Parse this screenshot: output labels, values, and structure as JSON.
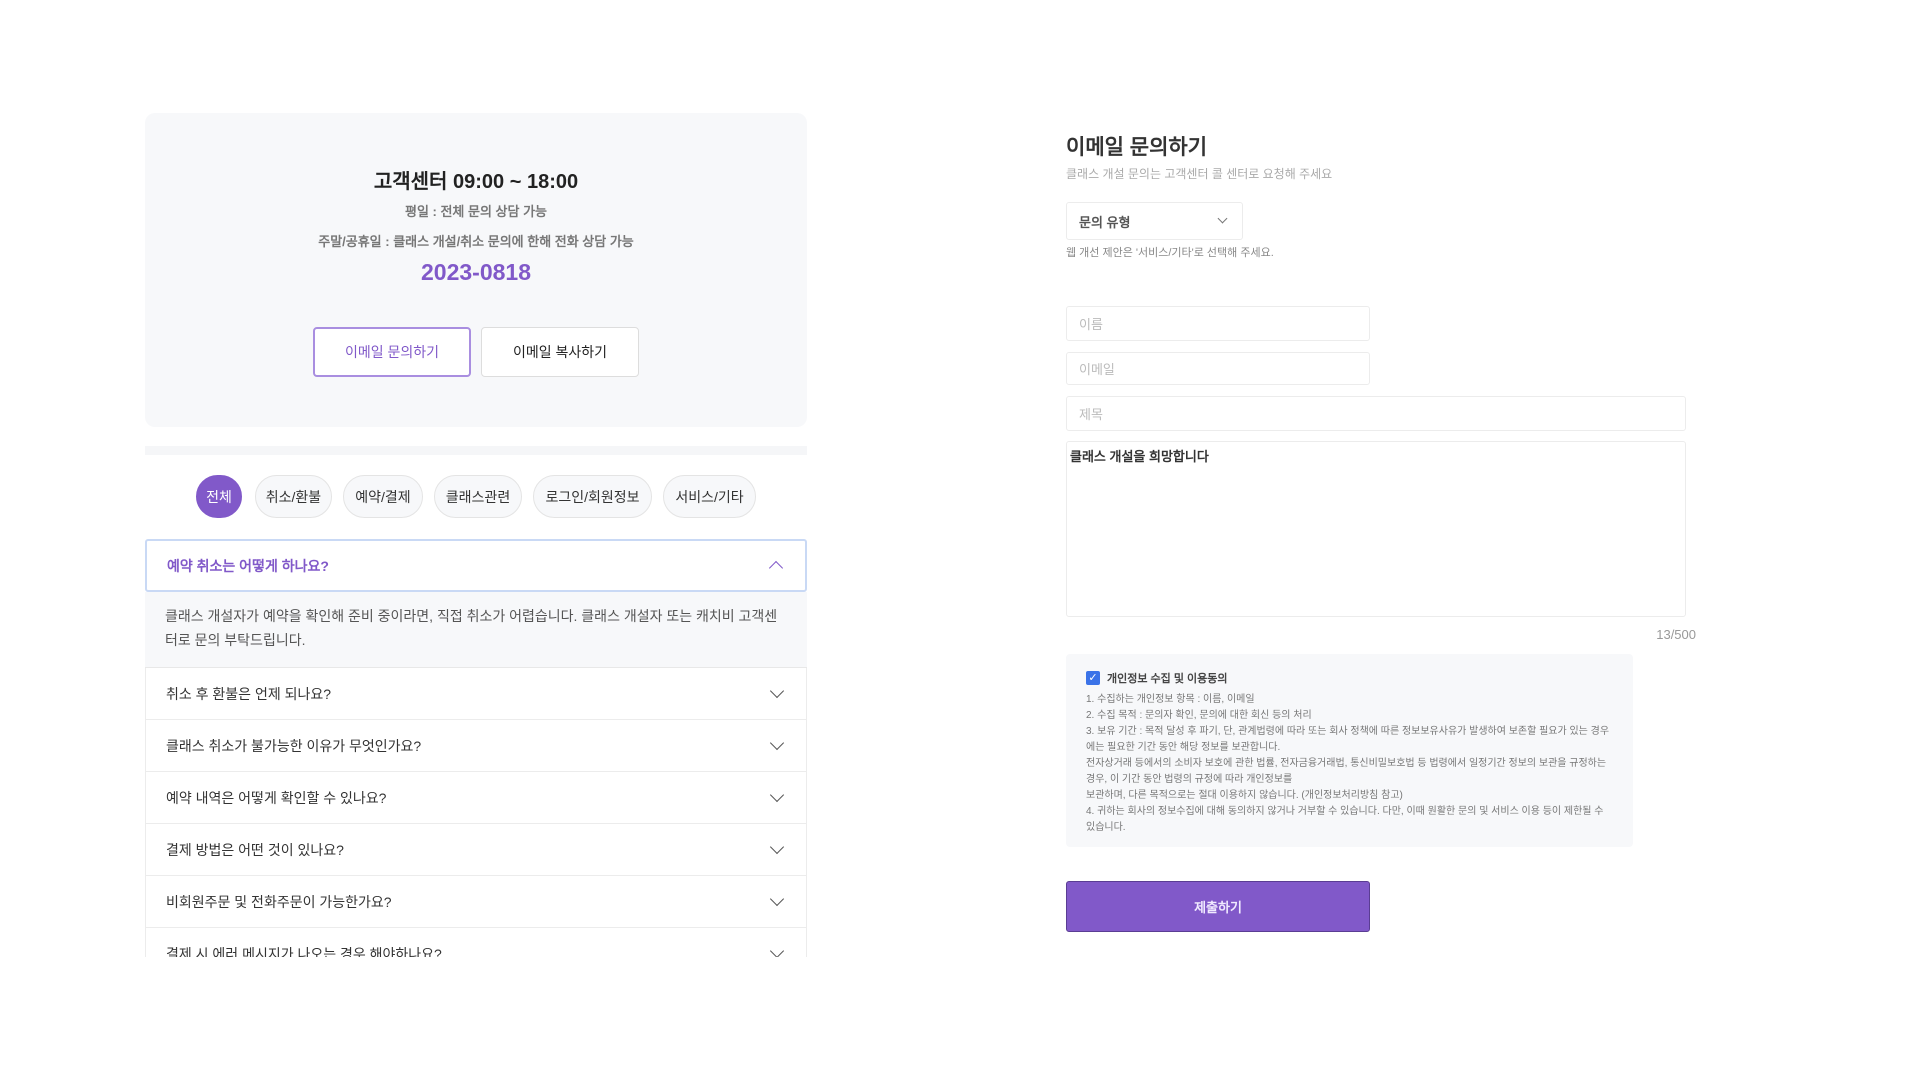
{
  "contact": {
    "title": "고객센터 09:00 ~ 18:00",
    "weekday": "평일 : 전체 문의 상담 가능",
    "weekend": "주말/공휴일 : 클래스 개설/취소 문의에 한해 전화 상담 가능",
    "phone": "2023-0818",
    "email_inquiry": "이메일 문의하기",
    "email_copy": "이메일 복사하기"
  },
  "tabs": [
    {
      "label": "전체",
      "active": true
    },
    {
      "label": "취소/환불"
    },
    {
      "label": "예약/결제"
    },
    {
      "label": "클래스관련"
    },
    {
      "label": "로그인/회원정보"
    },
    {
      "label": "서비스/기타"
    }
  ],
  "faq": {
    "open": {
      "q": "예약 취소는 어떻게 하나요?",
      "a": "클래스 개설자가 예약을 확인해 준비 중이라면, 직접 취소가 어렵습니다. 클래스 개설자 또는 캐치비 고객센터로 문의 부탁드립니다."
    },
    "items": [
      "취소 후 환불은 언제 되나요?",
      "클래스 취소가 불가능한 이유가 무엇인가요?",
      "예약 내역은 어떻게 확인할 수 있나요?",
      "결제 방법은 어떤 것이 있나요?",
      "비회원주문 및 전화주문이 가능한가요?",
      "결제 시 에러 메시지가 나오는 경우 해야하나요?"
    ]
  },
  "form": {
    "title": "이메일 문의하기",
    "subtitle": "클래스 개설 문의는 고객센터 콜 센터로 요청해 주세요",
    "type_select": "문의 유형",
    "type_hint": "웹 개선 제안은 '서비스/기타'로 선택해 주세요.",
    "name_placeholder": "이름",
    "email_placeholder": "이메일",
    "subject_placeholder": "제목",
    "message": "클래스 개설을 희망합니다",
    "counter": "13/500",
    "privacy": {
      "checked": true,
      "title": "개인정보 수집 및 이용동의",
      "lines": [
        "1. 수집하는 개인정보 항목 : 이름, 이메일",
        "2. 수집 목적 : 문의자 확인, 문의에 대한 회신 등의 처리",
        "3. 보유 기간 : 목적 달성 후 파기, 단, 관계법령에 따라 또는 회사 정책에 따른 정보보유사유가 발생하여 보존할 필요가 있는 경우에는 필요한 기간 동안 해당 정보를 보관합니다.",
        "전자상거래 등에서의 소비자 보호에 관한 법률, 전자금융거래법, 통신비밀보호법 등 법령에서 일정기간 정보의 보관을 규정하는 경우, 이 기간 동안 법령의 규정에 따라 개인정보를",
        "보관하며, 다른 목적으로는 절대 이용하지 않습니다. (개인정보처리방침 참고)",
        "4. 귀하는 회사의 정보수집에 대해 동의하지 않거나 거부할 수 있습니다. 다만, 이때 원활한 문의 및 서비스 이용 등이 제한될 수 있습니다."
      ]
    },
    "submit": "제출하기"
  },
  "colors": {
    "accent": "#8159c9"
  }
}
